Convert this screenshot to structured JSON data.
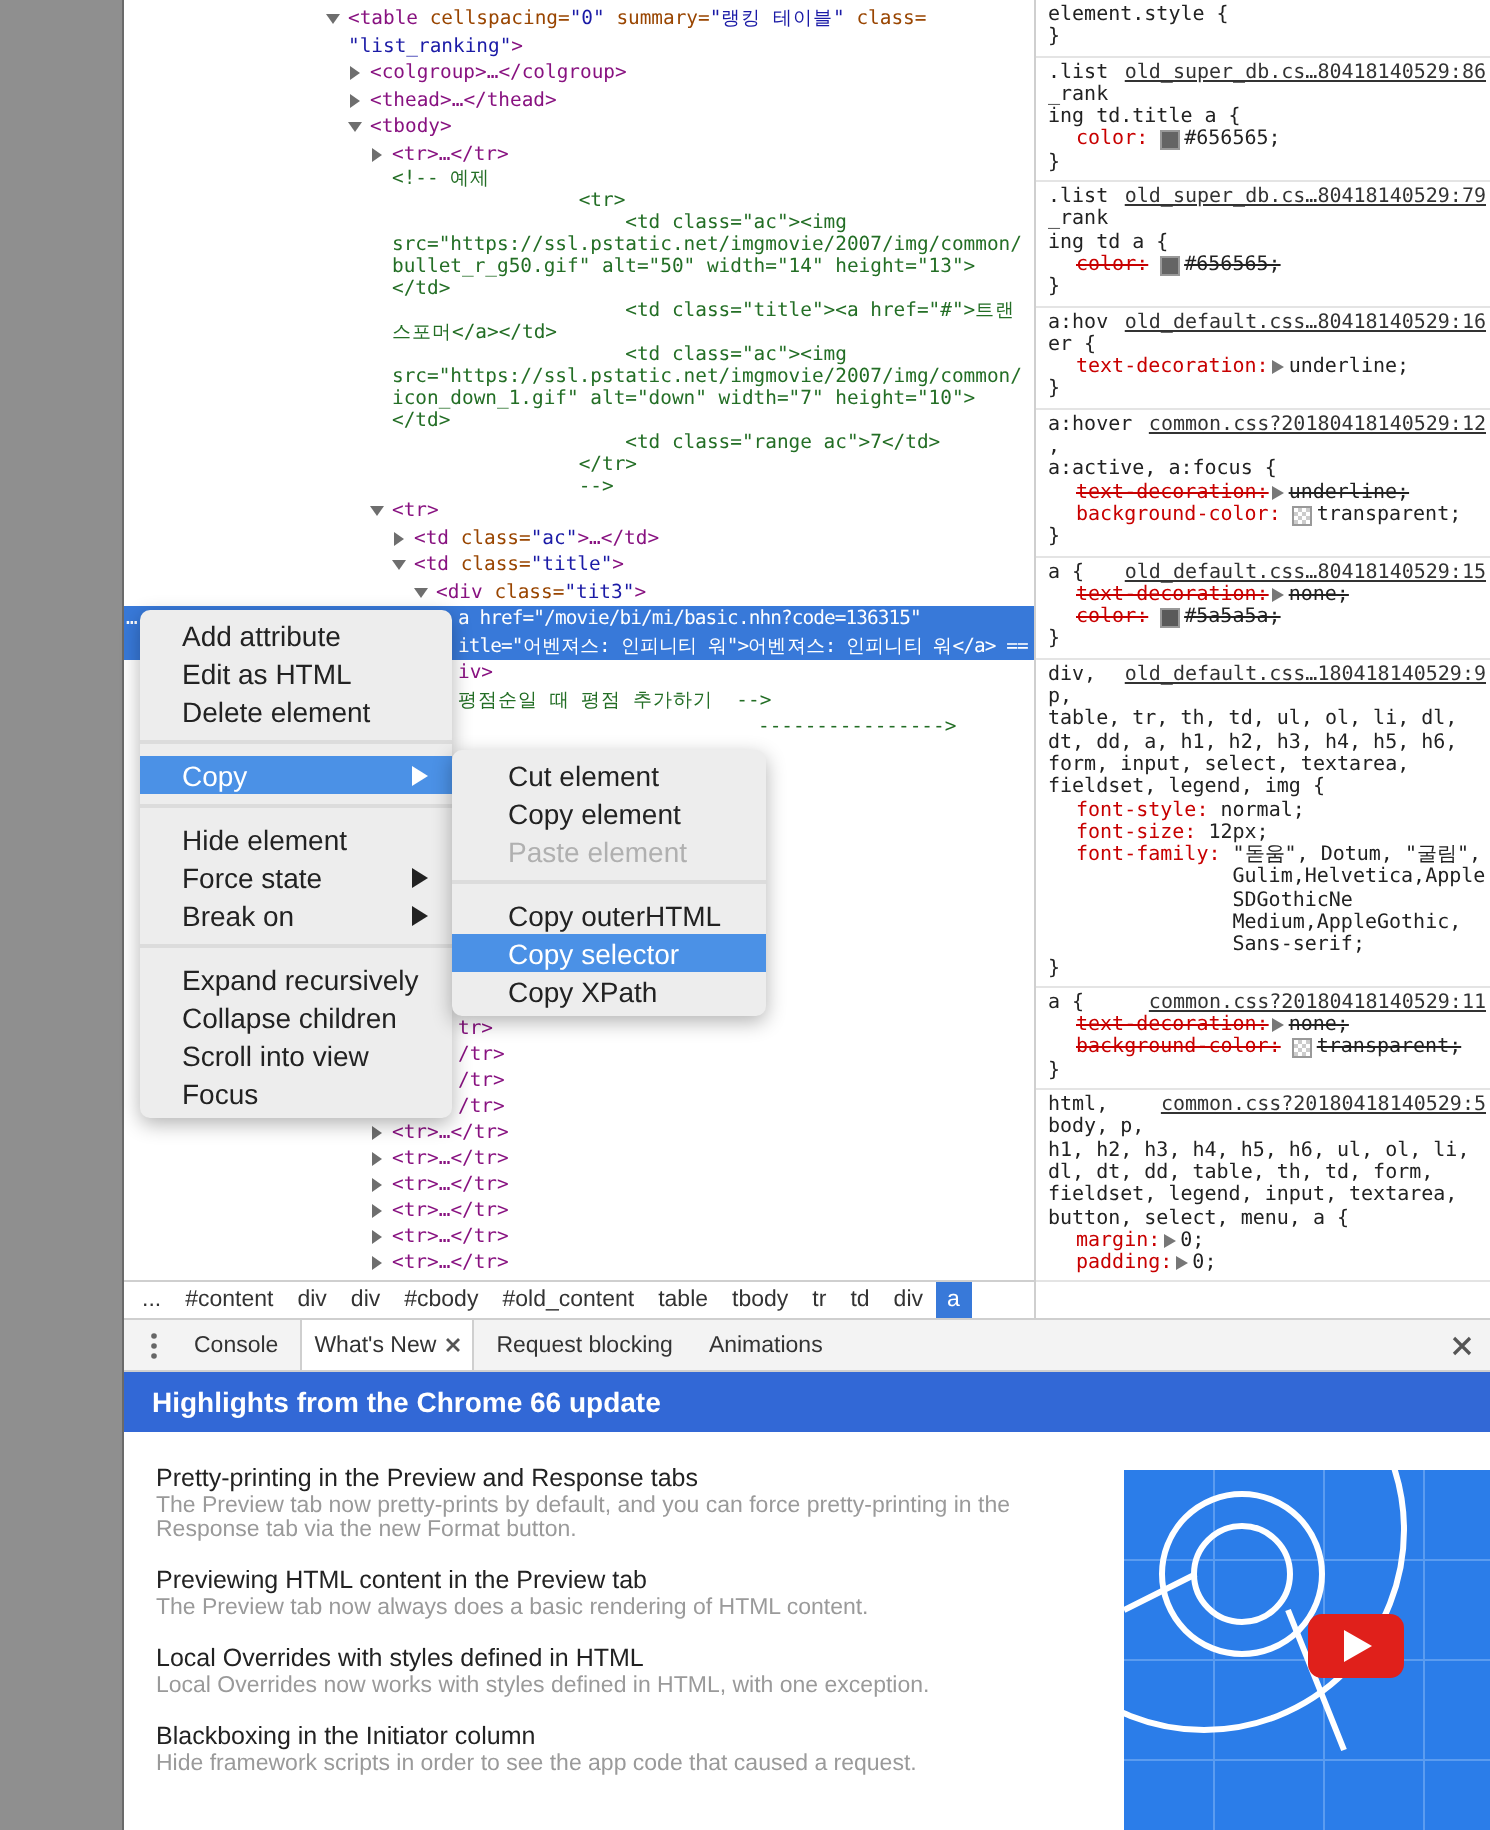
{
  "dom": {
    "tree": [
      {
        "kind": "element",
        "expanded": true,
        "selected": false,
        "lines": [
          "<table cellspacing=\"0\" summary=\"랭킹 테이블\" class=",
          "\"list_ranking\">"
        ],
        "children": [
          {
            "kind": "element",
            "expanded": false,
            "selected": false,
            "lines": [
              "<colgroup>…</colgroup>"
            ]
          },
          {
            "kind": "element",
            "expanded": false,
            "selected": false,
            "lines": [
              "<thead>…</thead>"
            ]
          },
          {
            "kind": "element",
            "expanded": true,
            "selected": false,
            "lines": [
              "<tbody>"
            ],
            "children": [
              {
                "kind": "element",
                "expanded": false,
                "selected": false,
                "lines": [
                  "<tr>…</tr>"
                ]
              },
              {
                "kind": "comment",
                "selected": false,
                "lines": [
                  "<!-- 예제",
                  "                <tr>",
                  "                    <td class=\"ac\"><img",
                  "src=\"https://ssl.pstatic.net/imgmovie/2007/img/common/",
                  "bullet_r_g50.gif\" alt=\"50\" width=\"14\" height=\"13\">",
                  "</td>",
                  "                    <td class=\"title\"><a href=\"#\">트랜",
                  "스포머</a></td>",
                  "                    <td class=\"ac\"><img",
                  "src=\"https://ssl.pstatic.net/imgmovie/2007/img/common/",
                  "icon_down_1.gif\" alt=\"down\" width=\"7\" height=\"10\">",
                  "</td>",
                  "                    <td class=\"range ac\">7</td>",
                  "                </tr>",
                  "                -->"
                ]
              },
              {
                "kind": "element",
                "expanded": true,
                "selected": false,
                "lines": [
                  "<tr>"
                ],
                "children": [
                  {
                    "kind": "element",
                    "expanded": false,
                    "selected": false,
                    "lines": [
                      "<td class=\"ac\">…</td>"
                    ]
                  },
                  {
                    "kind": "element",
                    "expanded": true,
                    "selected": false,
                    "lines": [
                      "<td class=\"title\">"
                    ],
                    "children": [
                      {
                        "kind": "element",
                        "expanded": true,
                        "selected": false,
                        "lines": [
                          "<div class=\"tit3\">"
                        ],
                        "children": [
                          {
                            "kind": "element",
                            "selected": true,
                            "gutter": "…",
                            "lines": [
                              "a href=\"/movie/bi/mi/basic.nhn?code=136315\"",
                              "itle=\"어벤져스: 인피니티 워\">어벤져스: 인피니티 워</a> =="
                            ]
                          },
                          {
                            "kind": "element",
                            "selected": false,
                            "lines": [
                              "iv>"
                            ]
                          },
                          {
                            "kind": "comment",
                            "selected": false,
                            "lines": [
                              "평점순일 때 평점 추가하기  -->"
                            ]
                          },
                          {
                            "kind": "comment-clipped",
                            "selected": false,
                            "lines": [
                              "---------------->"
                            ]
                          }
                        ]
                      }
                    ]
                  }
                ]
              }
            ]
          }
        ]
      }
    ],
    "tail": [
      {
        "kind": "clipped",
        "lines": [
          "tr>"
        ]
      },
      {
        "kind": "clipped",
        "lines": [
          "/tr>"
        ]
      },
      {
        "kind": "clipped",
        "lines": [
          "/tr>"
        ]
      },
      {
        "kind": "clipped",
        "lines": [
          "/tr>"
        ]
      },
      {
        "kind": "element",
        "expanded": false,
        "lines": [
          "<tr>…</tr>"
        ]
      },
      {
        "kind": "element",
        "expanded": false,
        "lines": [
          "<tr>…</tr>"
        ]
      },
      {
        "kind": "element",
        "expanded": false,
        "lines": [
          "<tr>…</tr>"
        ]
      },
      {
        "kind": "element",
        "expanded": false,
        "lines": [
          "<tr>…</tr>"
        ]
      },
      {
        "kind": "element",
        "expanded": false,
        "lines": [
          "<tr>…</tr>"
        ]
      },
      {
        "kind": "element",
        "expanded": false,
        "lines": [
          "<tr>…</tr>"
        ]
      }
    ]
  },
  "breadcrumb": [
    {
      "label": "...",
      "selected": false
    },
    {
      "label": "#content",
      "selected": false
    },
    {
      "label": "div",
      "selected": false
    },
    {
      "label": "div",
      "selected": false
    },
    {
      "label": "#cbody",
      "selected": false
    },
    {
      "label": "#old_content",
      "selected": false
    },
    {
      "label": "table",
      "selected": false
    },
    {
      "label": "tbody",
      "selected": false
    },
    {
      "label": "tr",
      "selected": false
    },
    {
      "label": "td",
      "selected": false
    },
    {
      "label": "div",
      "selected": false
    },
    {
      "label": "a",
      "selected": true
    }
  ],
  "styles": {
    "rules": [
      {
        "selector": [
          "element.style {"
        ],
        "close": "}"
      },
      {
        "selector": [
          ".list",
          "_rank",
          "ing td.title a {"
        ],
        "source": "old_super_db.cs…80418140529:86",
        "props": [
          {
            "name": "color:",
            "value": "#656565;",
            "swatch": true,
            "color": "#656565",
            "overridden": false,
            "expandable": false
          }
        ],
        "close": "}"
      },
      {
        "selector": [
          ".list",
          "_rank",
          "ing td a {"
        ],
        "source": "old_super_db.cs…80418140529:79",
        "props": [
          {
            "name": "color:",
            "value": "#656565;",
            "swatch": true,
            "color": "#656565",
            "overridden": true,
            "expandable": false
          }
        ],
        "close": "}"
      },
      {
        "selector": [
          "a:hov",
          "er {"
        ],
        "source": "old_default.css…80418140529:16",
        "props": [
          {
            "name": "text-decoration:",
            "value": "underline;",
            "swatch": false,
            "overridden": false,
            "expandable": true
          }
        ],
        "close": "}"
      },
      {
        "selector": [
          "a:hover",
          ",",
          "a:active, a:focus {"
        ],
        "source": "common.css?20180418140529:12",
        "props": [
          {
            "name": "text-decoration:",
            "value": "underline;",
            "swatch": false,
            "overridden": true,
            "expandable": true
          },
          {
            "name": "background-color:",
            "value": "transparent;",
            "swatch": true,
            "overridden": false,
            "expandable": false
          }
        ],
        "close": "}"
      },
      {
        "selector": [
          "a {"
        ],
        "source": "old_default.css…80418140529:15",
        "props": [
          {
            "name": "text-decoration:",
            "value": "none;",
            "swatch": false,
            "overridden": true,
            "expandable": true
          },
          {
            "name": "color:",
            "value": "#5a5a5a;",
            "swatch": true,
            "color": "#5a5a5a",
            "overridden": true,
            "expandable": false
          }
        ],
        "close": "}"
      },
      {
        "selector": [
          "div,",
          "p,",
          "table, tr, th, td, ul, ol, li, dl,",
          "dt, dd, a, h1, h2, h3, h4, h5, h6,",
          "form, input, select, textarea,",
          "fieldset, legend, img {"
        ],
        "source": "old_default.css…180418140529:9",
        "props": [
          {
            "name": "font-style:",
            "value": "normal;",
            "swatch": false,
            "overridden": false,
            "expandable": false
          },
          {
            "name": "font-size:",
            "value": "12px;",
            "swatch": false,
            "overridden": false,
            "expandable": false
          },
          {
            "name": "font-family:",
            "value": "\"돋움\", Dotum, \"굴림\", Gulim,Helvetica,AppleSDGothicNe Medium,AppleGothic, Sans-serif;",
            "swatch": false,
            "overridden": false,
            "expandable": false
          }
        ],
        "close": "}"
      },
      {
        "selector": [
          "a {"
        ],
        "source": "common.css?20180418140529:11",
        "props": [
          {
            "name": "text-decoration:",
            "value": "none;",
            "swatch": false,
            "overridden": true,
            "expandable": true
          },
          {
            "name": "background-color:",
            "value": "transparent;",
            "swatch": true,
            "overridden": true,
            "expandable": false
          }
        ],
        "close": "}"
      },
      {
        "selector": [
          "html,",
          "body, p,",
          "h1, h2, h3, h4, h5, h6, ul, ol, li,",
          "dl, dt, dd, table, th, td, form,",
          "fieldset, legend, input, textarea,",
          "button, select, menu, a {"
        ],
        "source": "common.css?20180418140529:5",
        "props": [
          {
            "name": "margin:",
            "value": "0;",
            "swatch": false,
            "overridden": false,
            "expandable": true
          },
          {
            "name": "padding:",
            "value": "0;",
            "swatch": false,
            "overridden": false,
            "expandable": true
          }
        ]
      }
    ]
  },
  "context_menu": {
    "groups": [
      {
        "items": [
          {
            "label": "Add attribute",
            "selected": false,
            "disabled": false,
            "has_submenu": false
          },
          {
            "label": "Edit as HTML",
            "selected": false,
            "disabled": false,
            "has_submenu": false
          },
          {
            "label": "Delete element",
            "selected": false,
            "disabled": false,
            "has_submenu": false
          }
        ]
      },
      {
        "items": [
          {
            "label": "Copy",
            "selected": true,
            "disabled": false,
            "has_submenu": true
          }
        ]
      },
      {
        "items": [
          {
            "label": "Hide element",
            "selected": false,
            "disabled": false,
            "has_submenu": false
          },
          {
            "label": "Force state",
            "selected": false,
            "disabled": false,
            "has_submenu": true
          },
          {
            "label": "Break on",
            "selected": false,
            "disabled": false,
            "has_submenu": true
          }
        ]
      },
      {
        "items": [
          {
            "label": "Expand recursively",
            "selected": false,
            "disabled": false,
            "has_submenu": false
          },
          {
            "label": "Collapse children",
            "selected": false,
            "disabled": false,
            "has_submenu": false
          },
          {
            "label": "Scroll into view",
            "selected": false,
            "disabled": false,
            "has_submenu": false
          },
          {
            "label": "Focus",
            "selected": false,
            "disabled": false,
            "has_submenu": false
          }
        ]
      }
    ],
    "submenu": {
      "groups": [
        {
          "items": [
            {
              "label": "Cut element",
              "selected": false,
              "disabled": false,
              "has_submenu": false
            },
            {
              "label": "Copy element",
              "selected": false,
              "disabled": false,
              "has_submenu": false
            },
            {
              "label": "Paste element",
              "selected": false,
              "disabled": true,
              "has_submenu": false
            }
          ]
        },
        {
          "items": [
            {
              "label": "Copy outerHTML",
              "selected": false,
              "disabled": false,
              "has_submenu": false
            },
            {
              "label": "Copy selector",
              "selected": true,
              "disabled": false,
              "has_submenu": false
            },
            {
              "label": "Copy XPath",
              "selected": false,
              "disabled": false,
              "has_submenu": false
            }
          ]
        }
      ]
    }
  },
  "drawer": {
    "tabs": [
      {
        "label": "Console",
        "selected": false,
        "closable": false
      },
      {
        "label": "What's New",
        "selected": true,
        "closable": true
      },
      {
        "label": "Request blocking",
        "selected": false,
        "closable": false
      },
      {
        "label": "Animations",
        "selected": false,
        "closable": false
      }
    ],
    "header": "Highlights from the Chrome 66 update",
    "items": [
      {
        "title": "Pretty-printing in the Preview and Response tabs",
        "description": "The Preview tab now pretty-prints by default, and you can force pretty-printing in the Response tab via the new Format button."
      },
      {
        "title": "Previewing HTML content in the Preview tab",
        "description": "The Preview tab now always does a basic rendering of HTML content."
      },
      {
        "title": "Local Overrides with styles defined in HTML",
        "description": "Local Overrides now works with styles defined in HTML, with one exception."
      },
      {
        "title": "Blackboxing in the Initiator column",
        "description": "Hide framework scripts in order to see the app code that caused a request."
      }
    ]
  }
}
